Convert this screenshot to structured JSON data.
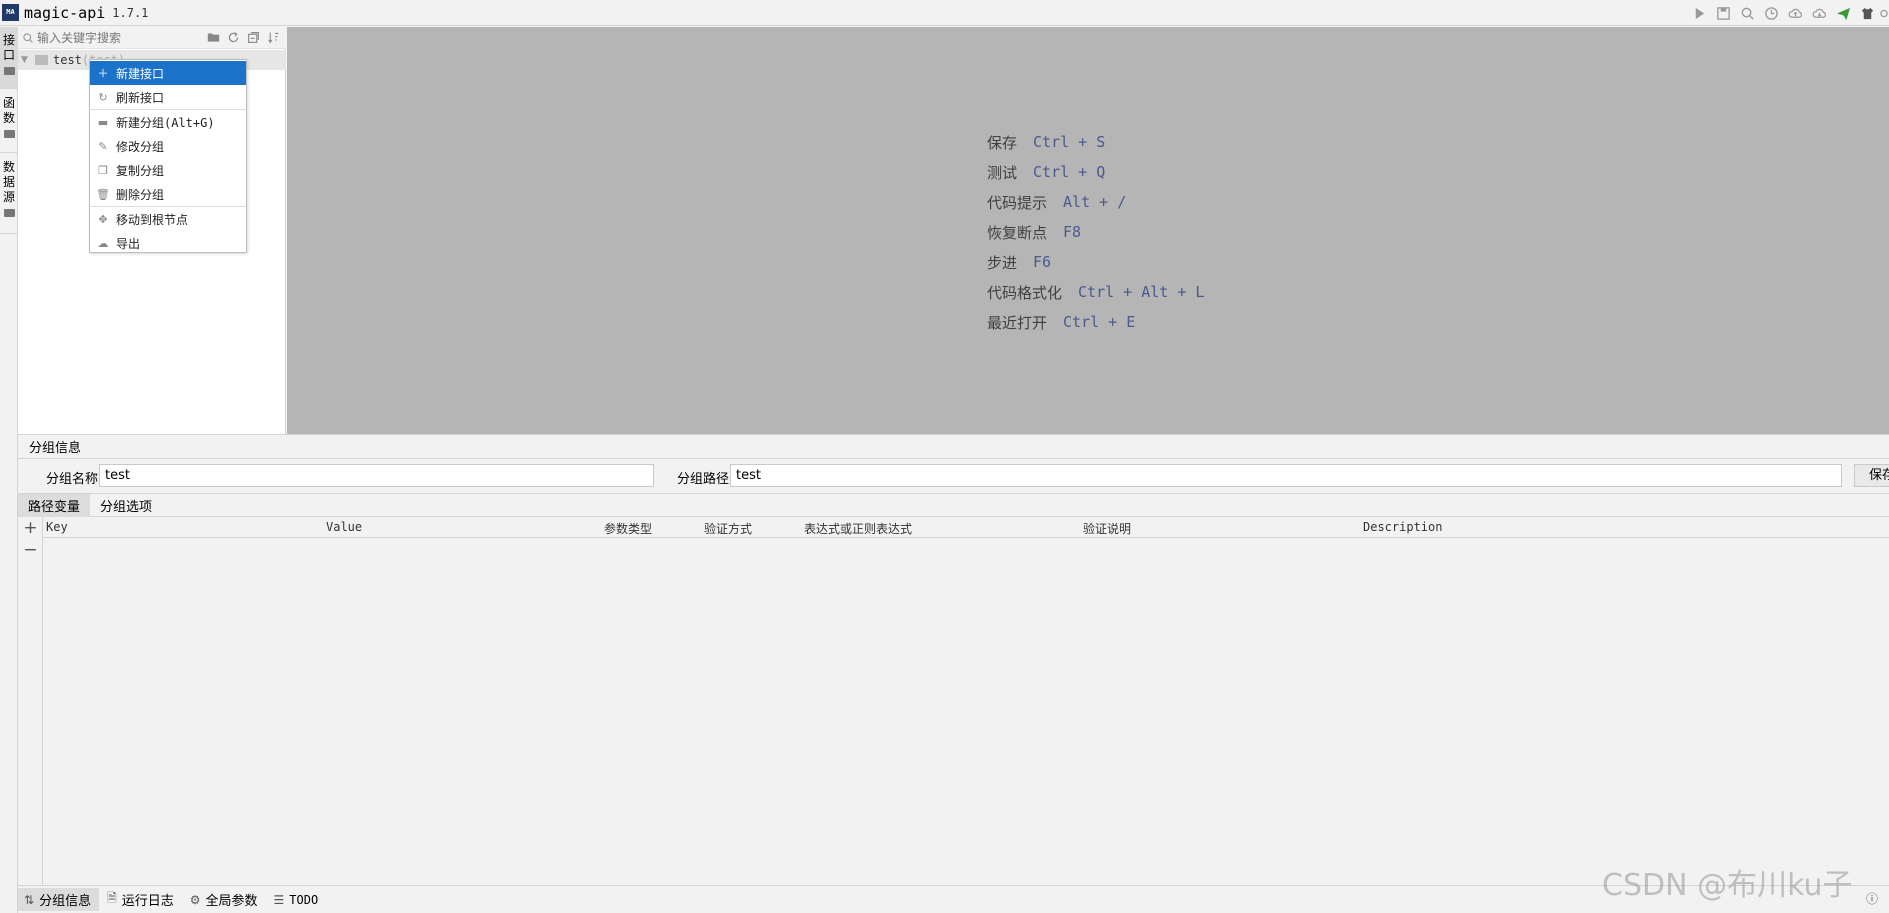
{
  "app": {
    "logo_text": "MA",
    "title": "magic-api",
    "version": "1.7.1"
  },
  "header_tools": [
    "play-icon",
    "save-icon",
    "search-icon",
    "history-icon",
    "cloud-upload-icon",
    "cloud-download-icon",
    "send-icon",
    "skin-icon",
    "settings-icon"
  ],
  "side_tabs": [
    {
      "label": "接口",
      "active": true
    },
    {
      "label": "函数",
      "active": false
    },
    {
      "label": "数据源",
      "active": false
    }
  ],
  "tree": {
    "search_placeholder": "输入关键字搜索",
    "tools": [
      "new-folder-icon",
      "refresh-icon",
      "collapse-icon",
      "sort-icon"
    ],
    "root": {
      "name": "test",
      "path": "(test)"
    }
  },
  "context_menu": [
    {
      "label": "新建接口",
      "icon": "plus-icon",
      "highlight": true
    },
    {
      "label": "刷新接口",
      "icon": "refresh-icon",
      "highlight": false
    },
    {
      "label": "新建分组(Alt+G)",
      "icon": "folder-icon",
      "highlight": false
    },
    {
      "label": "修改分组",
      "icon": "edit-icon",
      "highlight": false
    },
    {
      "label": "复制分组",
      "icon": "copy-icon",
      "highlight": false
    },
    {
      "label": "删除分组",
      "icon": "trash-icon",
      "highlight": false
    },
    {
      "label": "移动到根节点",
      "icon": "move-icon",
      "highlight": false
    },
    {
      "label": "导出",
      "icon": "export-icon",
      "highlight": false
    }
  ],
  "shortcuts": [
    {
      "label": "保存",
      "keys": "Ctrl + S"
    },
    {
      "label": "测试",
      "keys": "Ctrl + Q"
    },
    {
      "label": "代码提示",
      "keys": "Alt + /"
    },
    {
      "label": "恢复断点",
      "keys": "F8"
    },
    {
      "label": "步进",
      "keys": "F6"
    },
    {
      "label": "代码格式化",
      "keys": "Ctrl + Alt + L"
    },
    {
      "label": "最近打开",
      "keys": "Ctrl + E"
    }
  ],
  "group_info": {
    "title": "分组信息",
    "name_label": "分组名称",
    "name_value": "test",
    "path_label": "分组路径",
    "path_value": "test",
    "save_label": "保存"
  },
  "sub_tabs": [
    {
      "label": "路径变量",
      "active": true
    },
    {
      "label": "分组选项",
      "active": false
    }
  ],
  "param_table": {
    "columns": [
      "Key",
      "Value",
      "参数类型",
      "验证方式",
      "表达式或正则表达式",
      "验证说明",
      "Description"
    ],
    "rows": []
  },
  "status_bar": [
    {
      "label": "分组信息",
      "icon": "group-icon",
      "active": true
    },
    {
      "label": "运行日志",
      "icon": "log-icon",
      "active": false
    },
    {
      "label": "全局参数",
      "icon": "gear-icon",
      "active": false
    },
    {
      "label": "TODO",
      "icon": "list-icon",
      "active": false
    }
  ],
  "watermark": "CSDN @布川ku子",
  "status_right": "ⓘ"
}
